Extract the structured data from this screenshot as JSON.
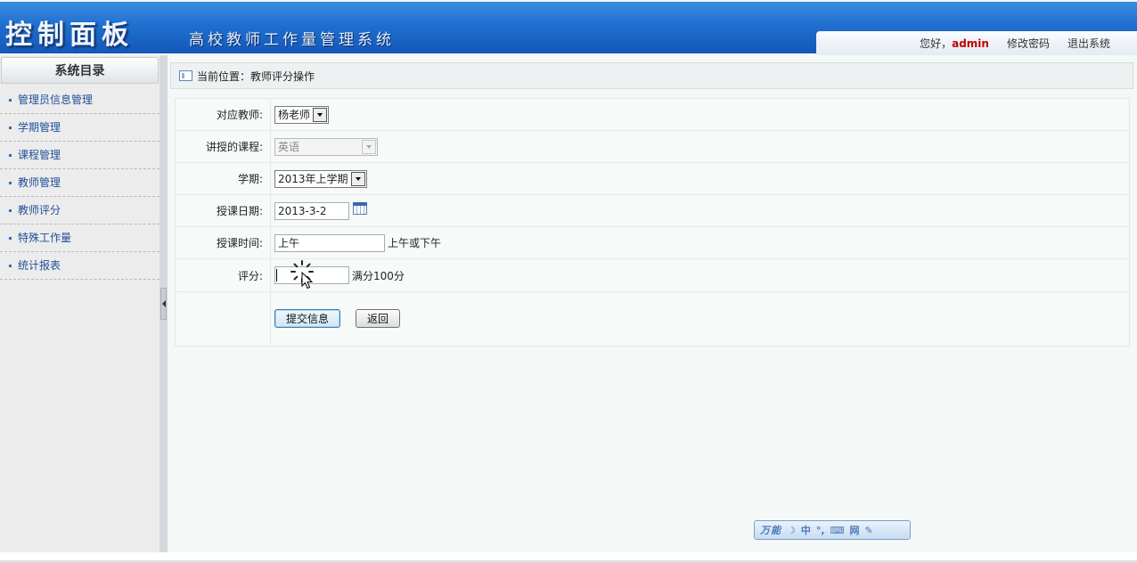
{
  "header": {
    "brand": "控制面板",
    "subtitle": "高校教师工作量管理系统",
    "greeting_prefix": "您好，",
    "username": "admin",
    "change_password": "修改密码",
    "logout": "退出系统"
  },
  "sidebar": {
    "title": "系统目录",
    "items": [
      {
        "label": "管理员信息管理"
      },
      {
        "label": "学期管理"
      },
      {
        "label": "课程管理"
      },
      {
        "label": "教师管理"
      },
      {
        "label": "教师评分"
      },
      {
        "label": "特殊工作量"
      },
      {
        "label": "统计报表"
      }
    ]
  },
  "breadcrumb": {
    "text": "当前位置：教师评分操作"
  },
  "form": {
    "teacher": {
      "label": "对应教师:",
      "value": "杨老师"
    },
    "course": {
      "label": "讲授的课程:",
      "value": "英语"
    },
    "term": {
      "label": "学期:",
      "value": "2013年上学期"
    },
    "date": {
      "label": "授课日期:",
      "value": "2013-3-2"
    },
    "time": {
      "label": "授课时间:",
      "value": "上午",
      "hint": "上午或下午"
    },
    "score": {
      "label": "评分:",
      "value": "",
      "hint": "满分100分"
    },
    "submit": "提交信息",
    "back": "返回"
  },
  "ime_bar": {
    "brand": "万能",
    "mode": "中",
    "items": [
      "moon-icon",
      "punctuation-icon",
      "keyboard-icon",
      "web-icon",
      "settings-icon"
    ]
  }
}
